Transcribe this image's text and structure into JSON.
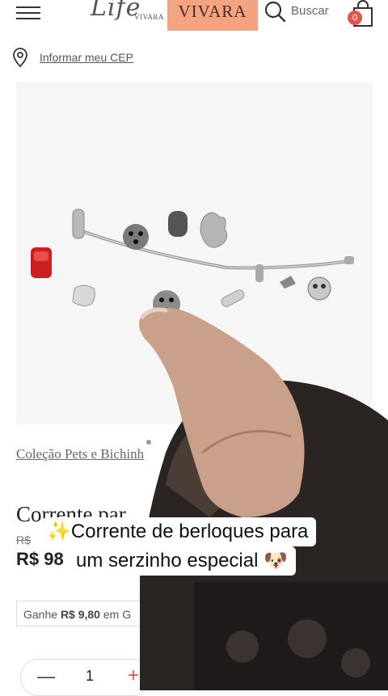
{
  "header": {
    "menu_icon": "hamburger-menu-icon",
    "logo_script": "Life",
    "logo_small": "VIVARA",
    "brand": "VIVARA",
    "search_label": "Buscar",
    "cart_count": "0"
  },
  "location": {
    "label": "Informar meu CEP",
    "icon": "location-pin-icon"
  },
  "product": {
    "collection": "Coleção Pets e Bichinh",
    "title": "Corrente par",
    "old_price": "R$",
    "price": "R$ 98",
    "cashback_prefix": "Ganhe",
    "cashback_value": "R$ 9,80",
    "cashback_suffix": "em G",
    "quantity": "1"
  },
  "overlay": {
    "caption_line1": "✨Corrente de berloques para",
    "caption_line2": "um serzinho especial 🐶"
  },
  "colors": {
    "brand_peach": "#f3a380",
    "accent_red": "#e2574c"
  }
}
